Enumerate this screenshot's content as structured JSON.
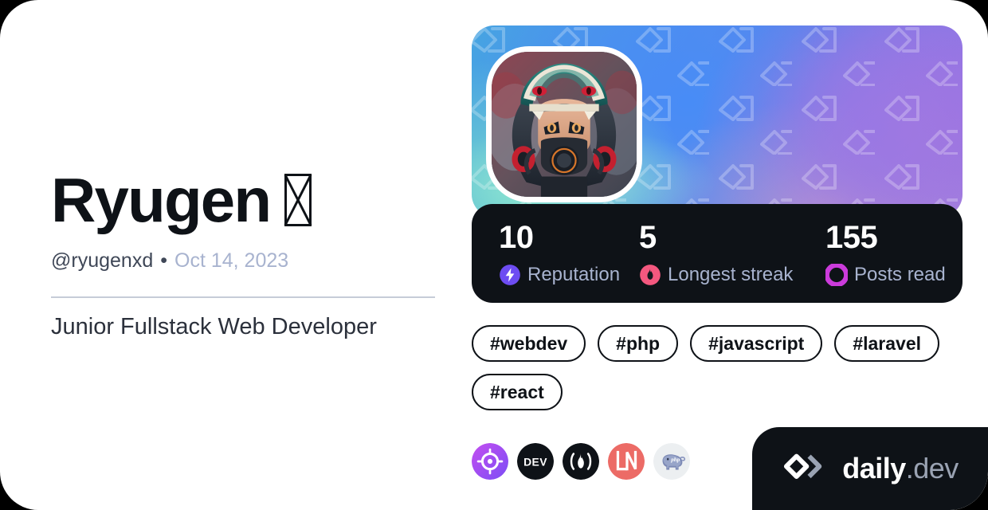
{
  "card": {
    "background_color": "#ffffff",
    "page_background": "#000000"
  },
  "profile": {
    "display_name": "Ryugen",
    "name_suffix_glyph": "missing-glyph-box",
    "handle": "@ryugenxd",
    "separator": "•",
    "joined_date": "Oct 14, 2023",
    "job_title": "Junior Fullstack Web Developer",
    "avatar_alt": "anime character with teal dragon headdress and red gas mask"
  },
  "stats": [
    {
      "value": "10",
      "label": "Reputation",
      "icon": "lightning-bolt-icon",
      "icon_color": "#6d4cf2"
    },
    {
      "value": "5",
      "label": "Longest streak",
      "icon": "flame-icon",
      "icon_color": "#f4587f"
    },
    {
      "value": "155",
      "label": "Posts read",
      "icon": "ring-icon",
      "icon_color": "#cb3bdb"
    }
  ],
  "tags": [
    {
      "label": "#webdev"
    },
    {
      "label": "#php"
    },
    {
      "label": "#javascript"
    },
    {
      "label": "#laravel"
    },
    {
      "label": "#react"
    }
  ],
  "socials": [
    {
      "name": "codepen-target-icon",
      "color": "#a855f7"
    },
    {
      "name": "devto-icon",
      "color": "#0e1217"
    },
    {
      "name": "hashnode-flame-icon",
      "color": "#0e1217"
    },
    {
      "name": "ln-icon",
      "color": "#ec6b66"
    },
    {
      "name": "php-elephant-icon",
      "color": "#6f7fae"
    }
  ],
  "brand": {
    "name_primary": "daily",
    "name_secondary": ".dev",
    "logo": "daily-dev-chevron-logo",
    "background_color": "#0e1217"
  }
}
